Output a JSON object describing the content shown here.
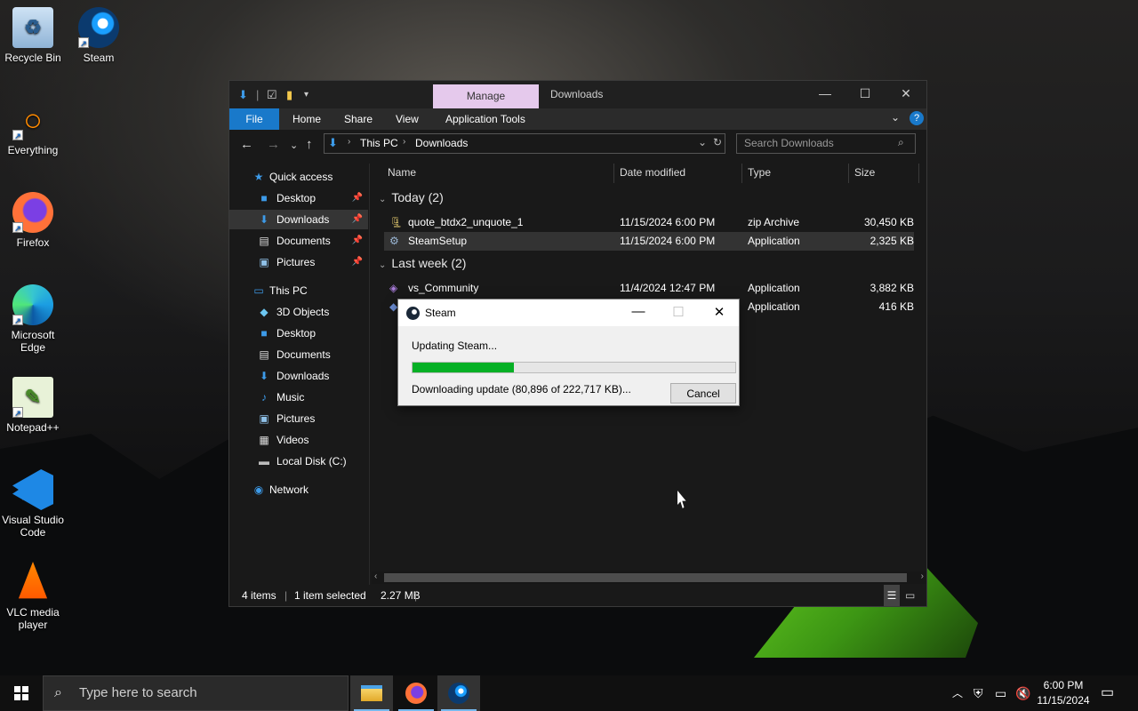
{
  "desktop": {
    "icons": [
      {
        "label": "Recycle Bin"
      },
      {
        "label": "Steam"
      },
      {
        "label": "Everything"
      },
      {
        "label": "Firefox"
      },
      {
        "label": "Microsoft Edge"
      },
      {
        "label": "Notepad++"
      },
      {
        "label": "Visual Studio Code"
      },
      {
        "label": "VLC media player"
      }
    ]
  },
  "explorer": {
    "context_tab": "Manage",
    "window_title": "Downloads",
    "ribbon_tabs": [
      "File",
      "Home",
      "Share",
      "View",
      "Application Tools"
    ],
    "breadcrumb": [
      "This PC",
      "Downloads"
    ],
    "search_placeholder": "Search Downloads",
    "columns": [
      "Name",
      "Date modified",
      "Type",
      "Size"
    ],
    "sidebar": {
      "quick_access": "Quick access",
      "quick_items": [
        "Desktop",
        "Downloads",
        "Documents",
        "Pictures"
      ],
      "this_pc": "This PC",
      "pc_items": [
        "3D Objects",
        "Desktop",
        "Documents",
        "Downloads",
        "Music",
        "Pictures",
        "Videos",
        "Local Disk (C:)"
      ],
      "network": "Network"
    },
    "groups": [
      {
        "label": "Today (2)",
        "files": [
          {
            "name": "quote_btdx2_unquote_1",
            "date": "11/15/2024 6:00 PM",
            "type": "zip Archive",
            "size": "30,450 KB"
          },
          {
            "name": "SteamSetup",
            "date": "11/15/2024 6:00 PM",
            "type": "Application",
            "size": "2,325 KB"
          }
        ]
      },
      {
        "label": "Last week (2)",
        "files": [
          {
            "name": "vs_Community",
            "date": "11/4/2024 12:47 PM",
            "type": "Application",
            "size": "3,882 KB"
          },
          {
            "name": "",
            "date": "",
            "type": "Application",
            "size": "416 KB"
          }
        ]
      }
    ],
    "status": {
      "items": "4 items",
      "selected": "1 item selected",
      "selected_size": "2.27 MB"
    }
  },
  "steam_dialog": {
    "title": "Steam",
    "message": "Updating Steam...",
    "progress_fraction": 0.315,
    "status": "Downloading update (80,896 of 222,717 KB)...",
    "cancel_label": "Cancel"
  },
  "taskbar": {
    "search_placeholder": "Type here to search",
    "time": "6:00 PM",
    "date": "11/15/2024"
  },
  "colors": {
    "file_tab": "#1979ca",
    "manage_tab": "#e5c9ec",
    "progress_fill": "#06b025"
  }
}
